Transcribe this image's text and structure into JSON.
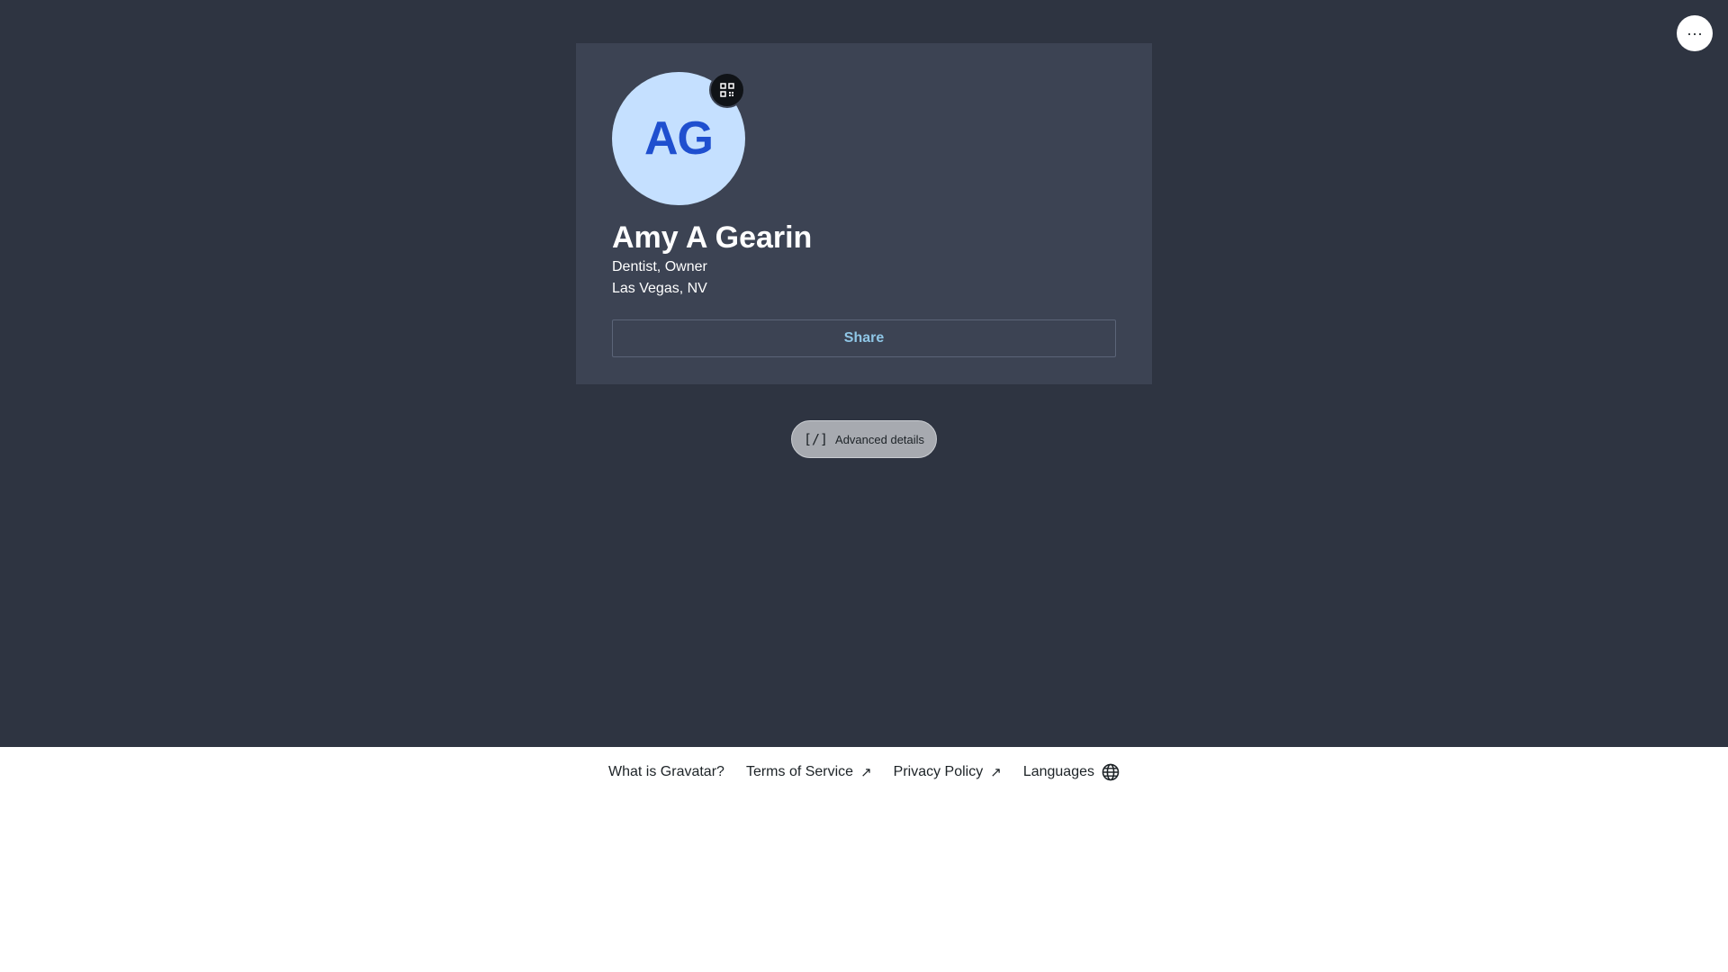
{
  "header": {
    "more_label": "···"
  },
  "profile": {
    "initials": "AG",
    "name": "Amy A Gearin",
    "job": "Dentist, Owner",
    "location": "Las Vegas, NV",
    "share_label": "Share",
    "avatar_bg": "#c5e0ff",
    "avatar_text_color": "#1f4fcf"
  },
  "advanced": {
    "icon_text": "[/]",
    "label": "Advanced details"
  },
  "footer": {
    "links": [
      {
        "label": "What is Gravatar?"
      },
      {
        "label": "Terms of Service",
        "icon": "↗"
      },
      {
        "label": "Privacy Policy",
        "icon": "↗"
      },
      {
        "label": "Languages"
      }
    ]
  },
  "colors": {
    "page_bg": "#2e3441",
    "card_bg": "#3c4353",
    "share_text": "#8fc6e6"
  }
}
